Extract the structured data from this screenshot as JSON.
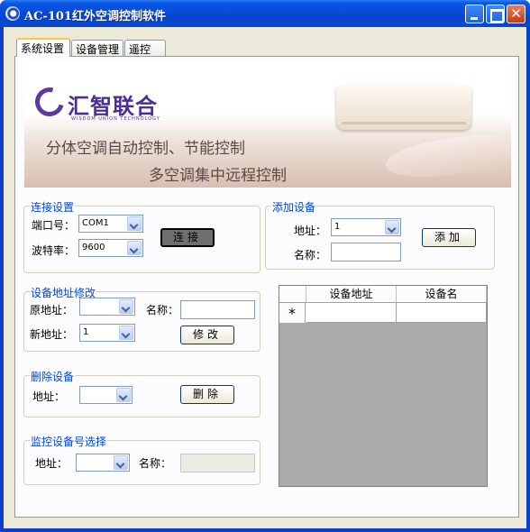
{
  "window": {
    "title": "AC-101红外空调控制软件",
    "minimize_glyph": "",
    "close_glyph": "✕"
  },
  "tabs": [
    {
      "label": "系统设置",
      "active": true
    },
    {
      "label": "设备管理",
      "active": false
    },
    {
      "label": "遥控",
      "active": false
    }
  ],
  "banner": {
    "logo_text": "汇智联合",
    "logo_subtext": "WISDOM UNION TECHNOLOGY",
    "slogan_line1": "分体空调自动控制、节能控制",
    "slogan_line2": "多空调集中远程控制"
  },
  "connection": {
    "title": "连接设置",
    "port_label": "端口号：",
    "port_value": "COM1",
    "baud_label": "波特率：",
    "baud_value": "9600",
    "connect_label": "连接"
  },
  "add_device": {
    "title": "添加设备",
    "address_label": "地址：",
    "address_value": "1",
    "name_label": "名称：",
    "name_value": "",
    "add_label": "添加"
  },
  "modify_address": {
    "title": "设备地址修改",
    "old_address_label": "原地址：",
    "old_address_value": "",
    "name_label": "名称：",
    "name_value": "",
    "new_address_label": "新地址：",
    "new_address_value": "1",
    "modify_label": "修改"
  },
  "delete_device": {
    "title": "删除设备",
    "address_label": "地址：",
    "address_value": "",
    "delete_label": "删除"
  },
  "monitor": {
    "title": "监控设备号选择",
    "address_label": "地址：",
    "address_value": "",
    "name_label": "名称：",
    "name_value": ""
  },
  "device_grid": {
    "columns": [
      "设备地址",
      "设备名"
    ],
    "new_row_marker": "*"
  },
  "colors": {
    "titlebar": "#0a56e6",
    "group_title": "#0046d5",
    "tab_accent": "#ffc83c",
    "face": "#ece9d8"
  }
}
